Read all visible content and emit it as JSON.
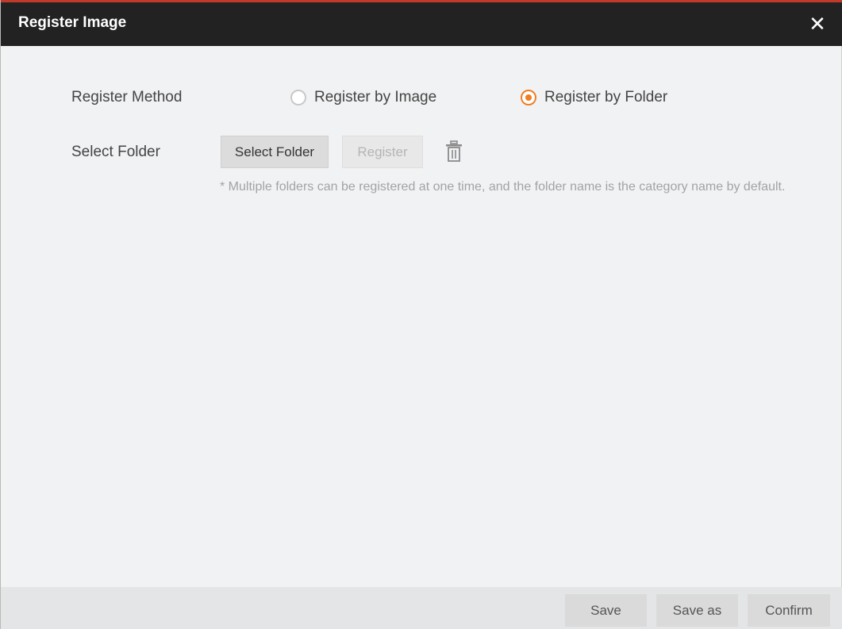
{
  "dialog": {
    "title": "Register Image",
    "close_symbol": "✕"
  },
  "register_method": {
    "label": "Register Method",
    "options": [
      {
        "label": "Register by Image",
        "checked": false
      },
      {
        "label": "Register by Folder",
        "checked": true
      }
    ]
  },
  "select_folder": {
    "label": "Select Folder",
    "select_button": "Select Folder",
    "register_button": "Register",
    "delete_icon": "trash-icon",
    "hint": "* Multiple folders can be registered at one time, and the folder name is the category name by default."
  },
  "footer": {
    "save": "Save",
    "save_as": "Save as",
    "confirm": "Confirm"
  },
  "colors": {
    "accent": "#f07d22",
    "titlebar": "#222222",
    "titlebar_top": "#c0392b"
  }
}
